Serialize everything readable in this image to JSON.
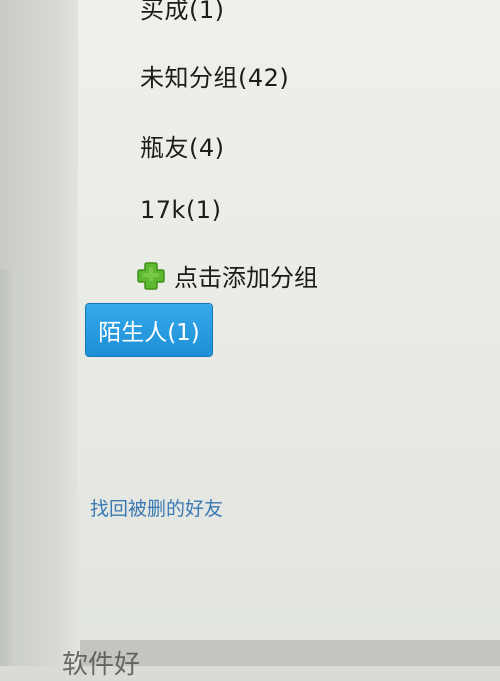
{
  "groups": [
    {
      "label": "买成(1)"
    },
    {
      "label": "未知分组(42)"
    },
    {
      "label": "瓶友(4)"
    },
    {
      "label": "17k(1)"
    }
  ],
  "add_group": {
    "label": "点击添加分组",
    "icon": "plus-icon",
    "icon_color": "#5cb82e"
  },
  "stranger_group": {
    "label": "陌生人(1)",
    "bg_color": "#2a9ee4"
  },
  "recover_friends": {
    "label": "找回被删的好友",
    "color": "#3b79b3"
  },
  "bottom_partial_text": {
    "label": "软件好"
  }
}
